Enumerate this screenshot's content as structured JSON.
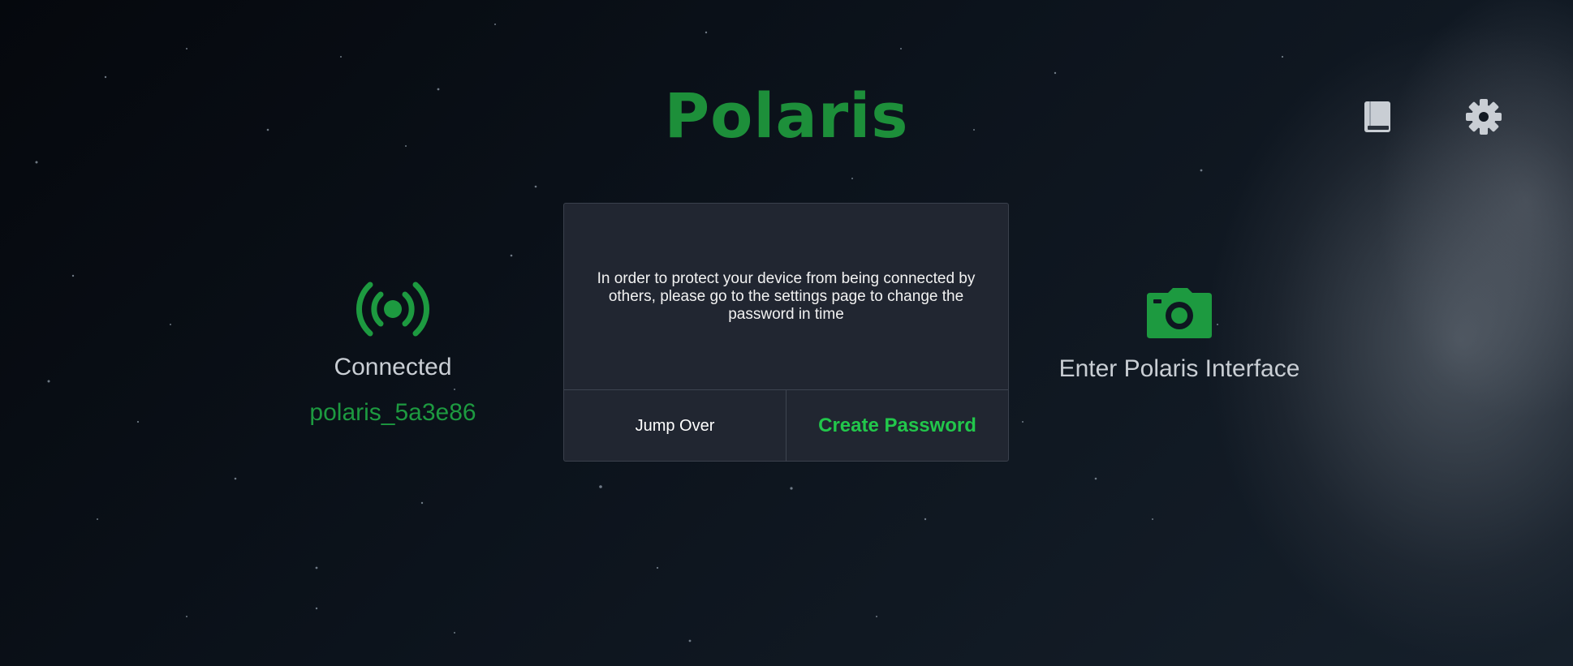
{
  "app": {
    "title": "Polaris"
  },
  "header": {
    "manual_icon": "book-icon",
    "settings_icon": "gear-icon"
  },
  "connection": {
    "icon": "signal-broadcast-icon",
    "status": "Connected",
    "ssid": "polaris_5a3e86"
  },
  "enter": {
    "icon": "camera-icon",
    "label": "Enter Polaris Interface"
  },
  "dialog": {
    "message": "In order to protect your device from being connected by others, please go to the settings page to change the password in time",
    "skip_label": "Jump Over",
    "create_label": "Create Password"
  },
  "colors": {
    "accent": "#1d8f3a",
    "accent_bright": "#22c74b",
    "dialog_bg": "#212631",
    "text_light": "#c9ced4"
  }
}
